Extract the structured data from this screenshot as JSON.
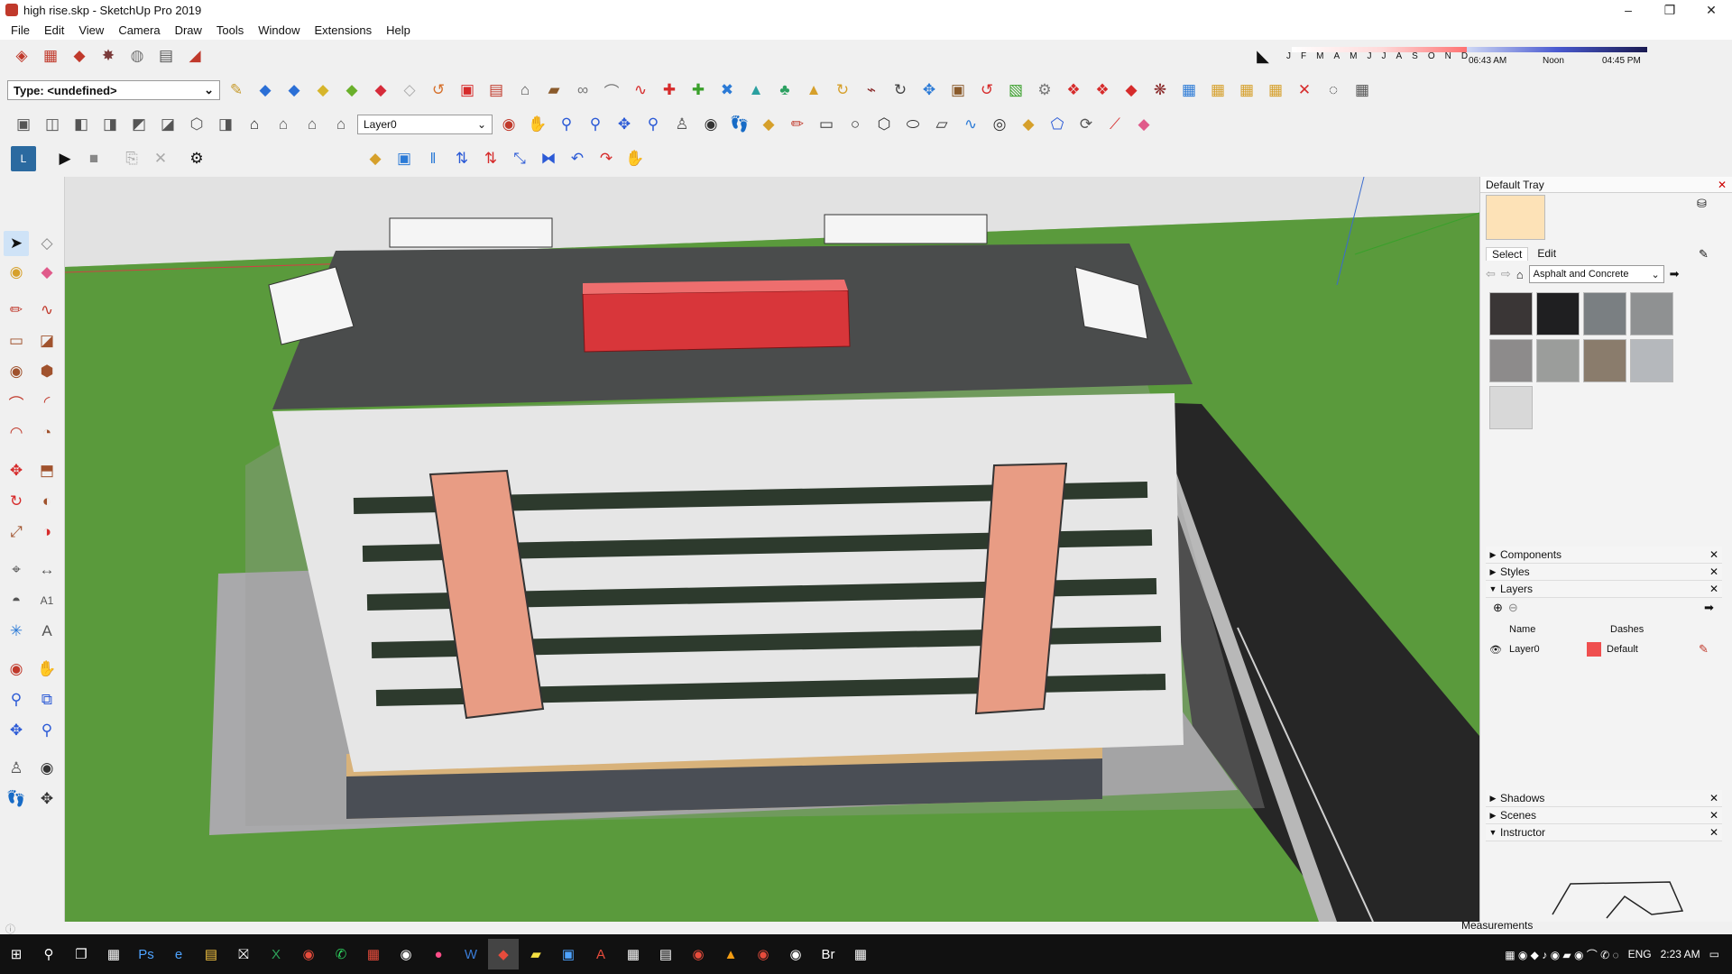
{
  "window": {
    "title": "high rise.skp - SketchUp Pro 2019",
    "minimize": "–",
    "restore": "❐",
    "close": "✕"
  },
  "menu": [
    "File",
    "Edit",
    "View",
    "Camera",
    "Draw",
    "Tools",
    "Window",
    "Extensions",
    "Help"
  ],
  "toolbar": {
    "type_dropdown": "Type: <undefined>",
    "layer_dropdown": "Layer0",
    "play_label": "▶",
    "stop_label": "■"
  },
  "shadow": {
    "months": [
      "J",
      "F",
      "M",
      "A",
      "M",
      "J",
      "J",
      "A",
      "S",
      "O",
      "N",
      "D"
    ],
    "time_start": "06:43 AM",
    "time_noon": "Noon",
    "time_end": "04:45 PM"
  },
  "tray": {
    "title": "Default Tray",
    "tabs": {
      "select": "Select",
      "edit": "Edit"
    },
    "collection": "Asphalt and Concrete",
    "swatches": [
      "#3a3636",
      "#1f1f21",
      "#7a7f82",
      "#8f9192",
      "#8d8b8b",
      "#9b9d9b",
      "#8a7c6c",
      "#b5b8bc",
      "#d8d8d8"
    ],
    "sections": {
      "components": "Components",
      "styles": "Styles",
      "layers": "Layers",
      "shadows": "Shadows",
      "scenes": "Scenes",
      "instructor": "Instructor"
    },
    "layers_table": {
      "col_name": "Name",
      "col_dashes": "Dashes",
      "row_name": "Layer0",
      "row_dashes": "Default",
      "row_color": "#ef4f4f"
    }
  },
  "status": {
    "measurements": "Measurements"
  },
  "taskbar": {
    "language": "ENG",
    "time": "2:23 AM"
  },
  "colors": {
    "sky": "#e2e2e2",
    "grass": "#5a9a3c",
    "road": "#262626",
    "roof": "#4a4c4c",
    "red_box": "#d8363a",
    "facade": "#efefef",
    "panel": "#e89c84"
  }
}
